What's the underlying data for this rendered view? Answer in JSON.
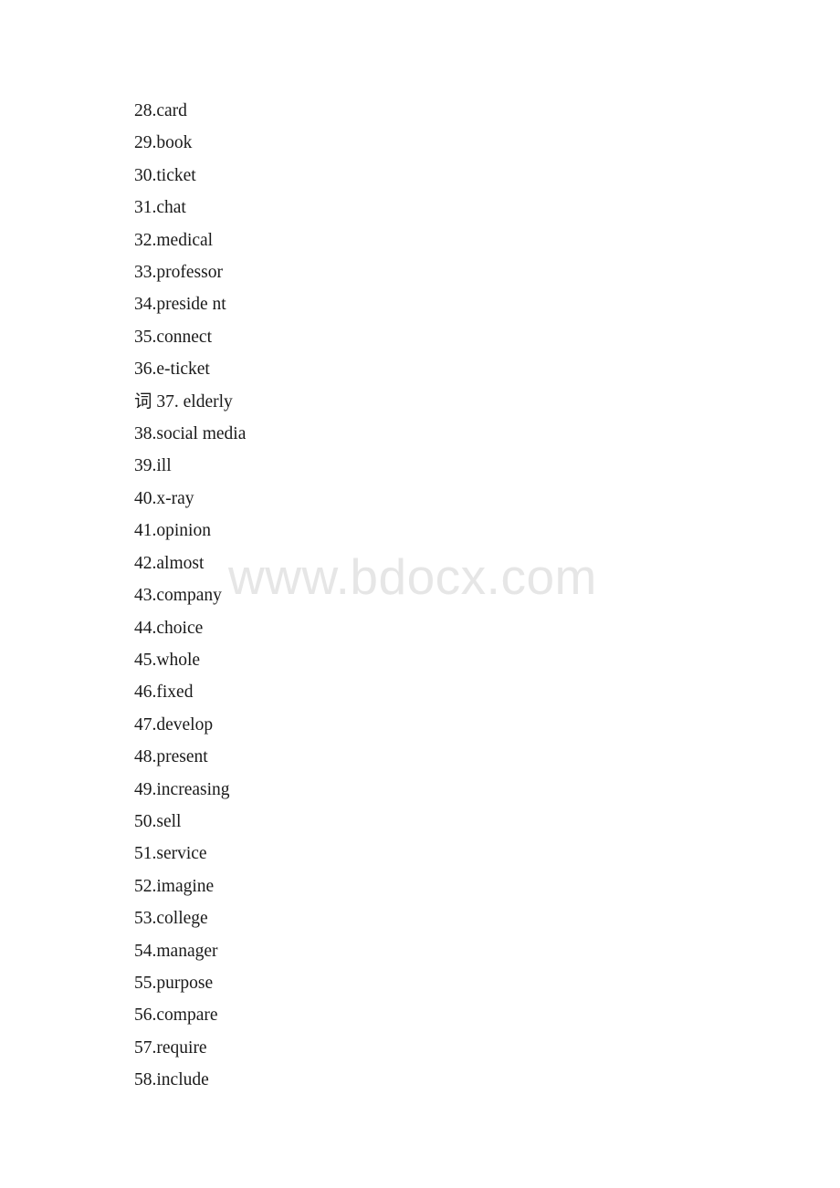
{
  "document": {
    "page_background": "#ffffff",
    "text_color": "#1a1a1a"
  },
  "watermark": {
    "text": "www.bdocx.com",
    "color": "#e6e6e6"
  },
  "word_list": {
    "items": [
      {
        "text": "28.card"
      },
      {
        "text": "29.book"
      },
      {
        "text": "30.ticket"
      },
      {
        "text": "31.chat"
      },
      {
        "text": "32.medical"
      },
      {
        "text": "33.professor"
      },
      {
        "text": "34.preside nt"
      },
      {
        "text": "35.connect"
      },
      {
        "text": "36.e-ticket"
      },
      {
        "text": "词 37. elderly"
      },
      {
        "text": "38.social media"
      },
      {
        "text": "39.ill"
      },
      {
        "text": "40.x-ray"
      },
      {
        "text": "41.opinion"
      },
      {
        "text": "42.almost"
      },
      {
        "text": "43.company"
      },
      {
        "text": "44.choice"
      },
      {
        "text": "45.whole"
      },
      {
        "text": "46.fixed"
      },
      {
        "text": "47.develop"
      },
      {
        "text": "48.present"
      },
      {
        "text": "49.increasing"
      },
      {
        "text": "50.sell"
      },
      {
        "text": "51.service"
      },
      {
        "text": "52.imagine"
      },
      {
        "text": "53.college"
      },
      {
        "text": "54.manager"
      },
      {
        "text": "55.purpose"
      },
      {
        "text": "56.compare"
      },
      {
        "text": "57.require"
      },
      {
        "text": "58.include"
      }
    ]
  }
}
